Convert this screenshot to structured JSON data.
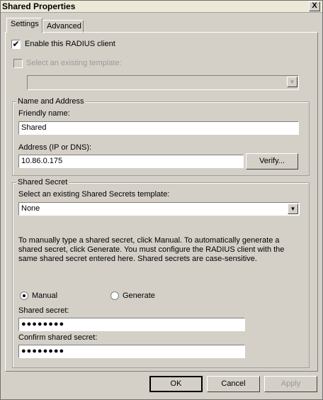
{
  "window": {
    "title": "Shared Properties",
    "close_symbol": "X"
  },
  "tabs": [
    {
      "label": "Settings",
      "active": true
    },
    {
      "label": "Advanced",
      "active": false
    }
  ],
  "settings": {
    "enable_client_label": "Enable this RADIUS client",
    "enable_client_checked": true,
    "select_template_label": "Select an existing template:",
    "select_template_checked": false,
    "template_value": ""
  },
  "name_address": {
    "group_label": "Name and Address",
    "friendly_name_label": "Friendly name:",
    "friendly_name_value": "Shared",
    "address_label": "Address (IP or DNS):",
    "address_value": "10.86.0.175",
    "verify_label": "Verify..."
  },
  "shared_secret": {
    "group_label": "Shared Secret",
    "template_label": "Select an existing Shared Secrets template:",
    "template_value": "None",
    "description": "To manually type a shared secret, click Manual. To automatically generate a shared secret, click Generate. You must configure the RADIUS client with the same shared secret entered here. Shared secrets are case-sensitive.",
    "manual_label": "Manual",
    "generate_label": "Generate",
    "selected_mode": "Manual",
    "secret_label": "Shared secret:",
    "secret_value": "●●●●●●●●",
    "confirm_label": "Confirm shared secret:",
    "confirm_value": "●●●●●●●●"
  },
  "footer": {
    "ok_label": "OK",
    "cancel_label": "Cancel",
    "apply_label": "Apply"
  },
  "icons": {
    "dropdown_arrow": "▼",
    "checkmark": "✔"
  }
}
